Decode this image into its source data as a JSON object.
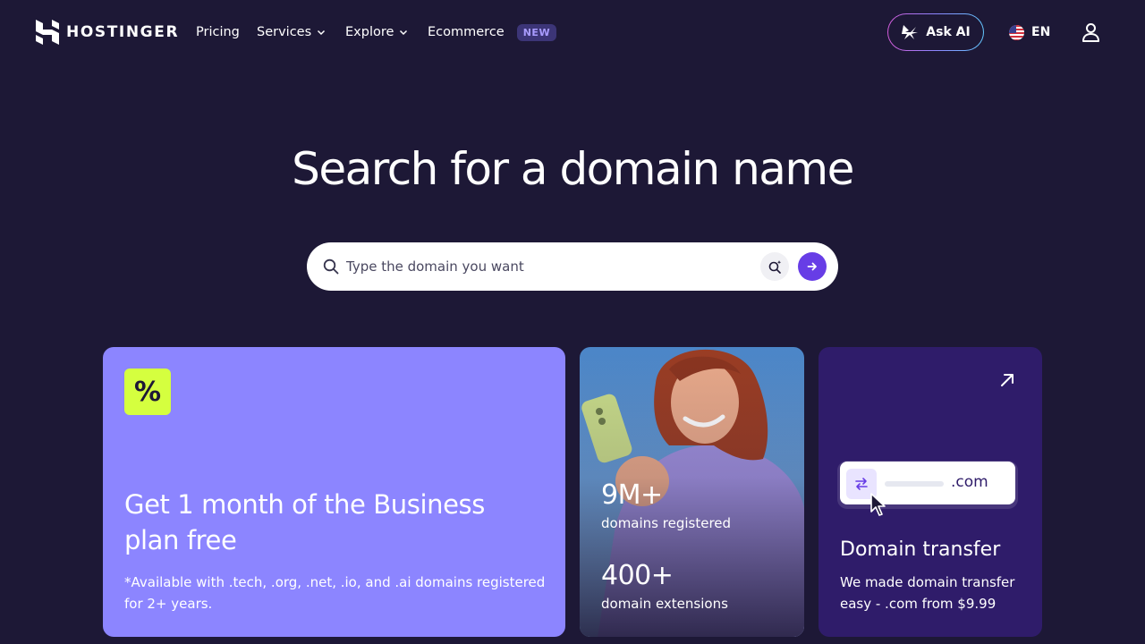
{
  "header": {
    "brand": "HOSTINGER",
    "nav": [
      {
        "label": "Pricing"
      },
      {
        "label": "Services"
      },
      {
        "label": "Explore"
      },
      {
        "label": "Ecommerce",
        "badge": "NEW"
      }
    ],
    "ask_ai_label": "Ask AI",
    "language": "EN"
  },
  "hero": {
    "title": "Search for a domain name",
    "search_placeholder": "Type the domain you want"
  },
  "cards": {
    "promo": {
      "badge": "%",
      "title": "Get 1 month of the Business plan free",
      "note": "*Available with .tech, .org, .net, .io, and .ai domains registered for 2+ years."
    },
    "stats": {
      "stat1_value": "9M+",
      "stat1_label": "domains registered",
      "stat2_value": "400+",
      "stat2_label": "domain extensions"
    },
    "transfer": {
      "mock_extension": ".com",
      "title": "Domain transfer",
      "description": "We made domain transfer easy - .com from $9.99"
    }
  },
  "colors": {
    "background": "#1d1836",
    "primary": "#673de6",
    "promo_card": "#8c85ff",
    "promo_badge": "#d5ff3f",
    "transfer_card": "#2f1c6a"
  },
  "icons": [
    "hostinger-logo-icon",
    "chevron-down-icon",
    "ask-ai-sparkle-icon",
    "us-flag-icon",
    "user-icon",
    "search-icon",
    "ai-search-icon",
    "arrow-right-icon",
    "arrow-up-right-icon",
    "transfer-arrows-icon",
    "cursor-icon"
  ]
}
